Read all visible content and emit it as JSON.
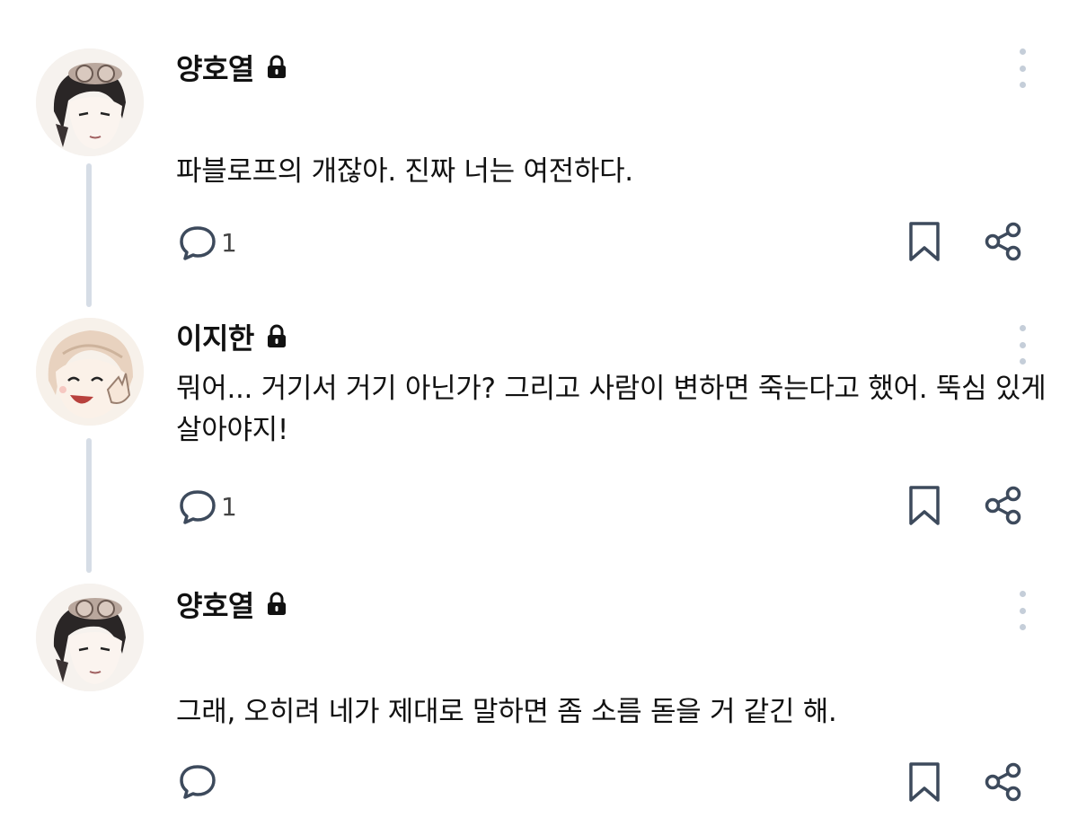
{
  "posts": [
    {
      "author": "양호열",
      "author_icon": "lock-icon",
      "avatar": "dark-haired-goggles-avatar",
      "text": "파블로프의 개잖아. 진짜 너는 여전하다.",
      "reply_count": "1"
    },
    {
      "author": "이지한",
      "author_icon": "lock-icon",
      "avatar": "light-haired-smiling-avatar",
      "text": "뭐어... 거기서 거기 아닌가? 그리고 사람이 변하면 죽는다고 했어. 뚝심 있게 살아야지!",
      "reply_count": "1"
    },
    {
      "author": "양호열",
      "author_icon": "lock-icon",
      "avatar": "dark-haired-goggles-avatar",
      "text": "그래, 오히려 네가 제대로 말하면 좀 소름 돋을 거 같긴 해.",
      "reply_count": ""
    }
  ],
  "colors": {
    "connector": "#d6dde6",
    "icon_stroke": "#3d4a5c",
    "more_dots": "#c5ced9",
    "text": "#111111"
  }
}
